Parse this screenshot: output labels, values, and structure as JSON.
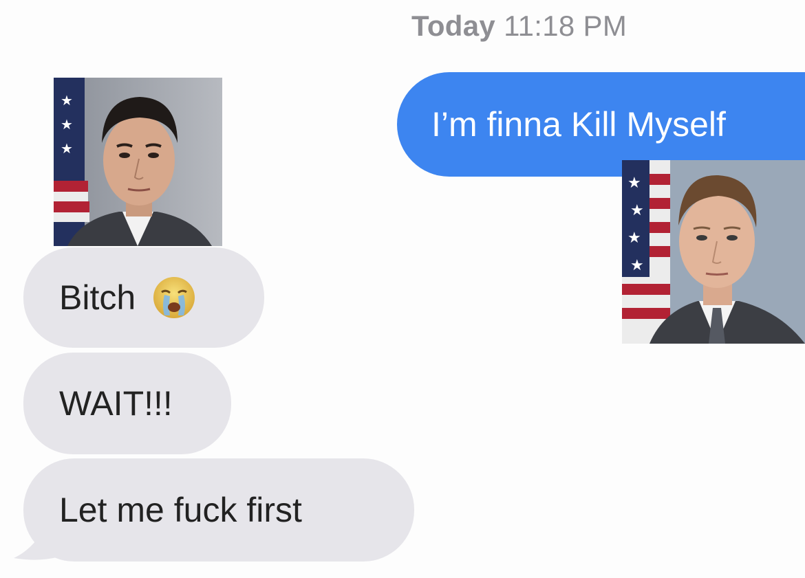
{
  "header": {
    "timestamp_day": "Today",
    "timestamp_time": "11:18 PM"
  },
  "messages": {
    "sent": [
      {
        "text": "I’m finna Kill Myself"
      }
    ],
    "received": [
      {
        "text": "Bitch",
        "emoji": "crying-face-emoji"
      },
      {
        "text": "WAIT!!!"
      },
      {
        "text": "Let me fuck first"
      }
    ]
  },
  "colors": {
    "sent_bubble": "#3d85f0",
    "received_bubble": "#e6e5ea",
    "timestamp": "#8e8e93"
  }
}
